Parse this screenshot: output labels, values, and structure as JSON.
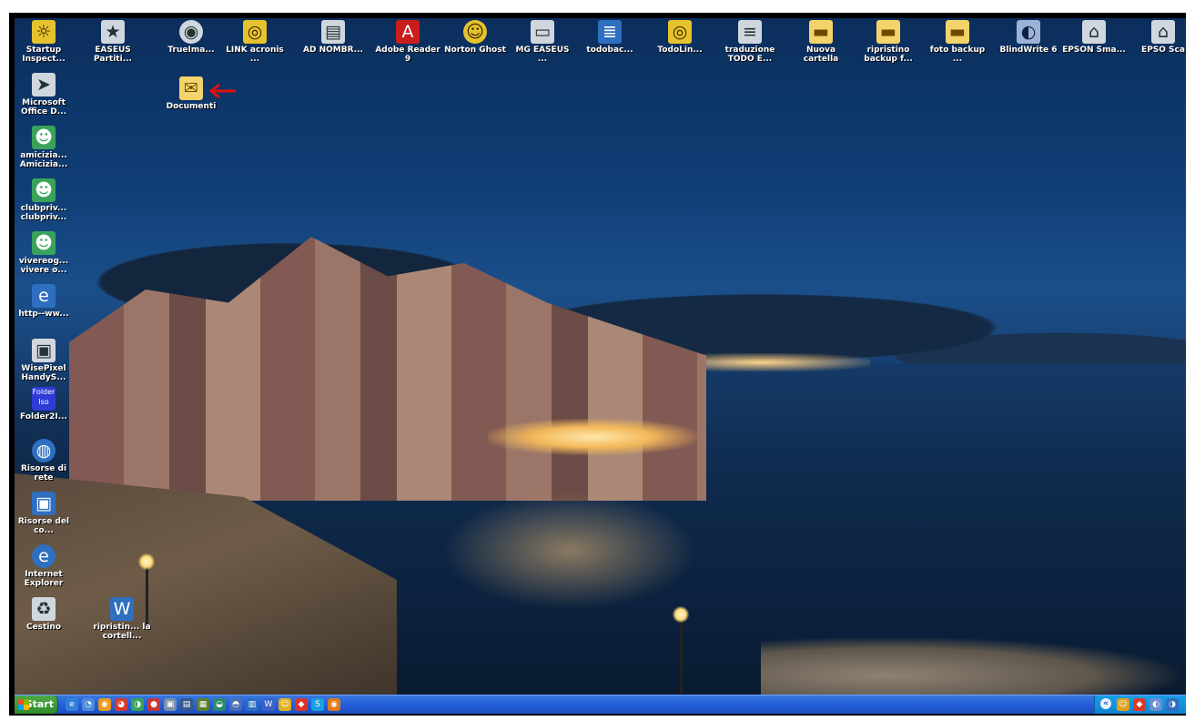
{
  "desktop_icons_top_row": [
    {
      "id": "startup-inspector",
      "label": "Startup Inspect...",
      "icon": "startup-inspector-icon"
    },
    {
      "id": "easeus-partition",
      "label": "EASEUS Partiti...",
      "icon": "easeus-icon"
    },
    {
      "id": "trueimage",
      "label": "TrueIma...",
      "icon": "trueimage-icon"
    },
    {
      "id": "link-acronis",
      "label": "LINK acronis ...",
      "icon": "image-file-icon"
    },
    {
      "id": "ad-nombre",
      "label": "AD NOMBR...",
      "icon": "document-shortcut-icon"
    },
    {
      "id": "adobe-reader",
      "label": "Adobe Reader 9",
      "icon": "adobe-reader-icon"
    },
    {
      "id": "norton-ghost",
      "label": "Norton Ghost",
      "icon": "norton-ghost-icon"
    },
    {
      "id": "mg-easeus",
      "label": "MG EASEUS ...",
      "icon": "drive-icon"
    },
    {
      "id": "todobackup-archive",
      "label": "todobac...",
      "icon": "archive-icon"
    },
    {
      "id": "todolink",
      "label": "TodoLin...",
      "icon": "image-file-icon"
    },
    {
      "id": "traduzione-todo",
      "label": "traduzione TODO E...",
      "icon": "text-file-icon"
    },
    {
      "id": "nuova-cartella",
      "label": "Nuova cartella",
      "icon": "folder-icon"
    },
    {
      "id": "ripristino-backup",
      "label": "ripristino backup f...",
      "icon": "folder-icon"
    },
    {
      "id": "foto-backup",
      "label": "foto backup ...",
      "icon": "folder-icon"
    },
    {
      "id": "blindwrite",
      "label": "BlindWrite 6",
      "icon": "disc-icon"
    },
    {
      "id": "epson-smart",
      "label": "EPSON Sma...",
      "icon": "scanner-icon"
    },
    {
      "id": "epson-scan",
      "label": "EPSO Sca",
      "icon": "scanner-icon"
    }
  ],
  "desktop_icons_left_column": [
    {
      "id": "office-doc",
      "label": "Microsoft Office D...",
      "icon": "office-shortcut-icon"
    },
    {
      "id": "amicizia",
      "label": "amicizia... Amicizia...",
      "icon": "users-icon"
    },
    {
      "id": "clubpriv",
      "label": "clubpriv... clubpriv...",
      "icon": "users-icon"
    },
    {
      "id": "vivereog",
      "label": "vivereog... vivere o...",
      "icon": "users-icon"
    },
    {
      "id": "http-ww",
      "label": "http--ww...",
      "icon": "internet-shortcut-icon"
    },
    {
      "id": "wisepixel",
      "label": "WisePixel HandyS...",
      "icon": "camera-icon"
    },
    {
      "id": "folder2iso",
      "label": "Folder2I...",
      "icon": "folder2iso-icon",
      "icon_text": "Folder Iso"
    },
    {
      "id": "risorse-rete",
      "label": "Risorse di rete",
      "icon": "network-icon"
    },
    {
      "id": "risorse-computer",
      "label": "Risorse del co...",
      "icon": "computer-icon"
    },
    {
      "id": "internet-explorer",
      "label": "Internet Explorer",
      "icon": "internet-explorer-icon"
    },
    {
      "id": "cestino",
      "label": "Cestino",
      "icon": "recycle-bin-icon"
    }
  ],
  "desktop_other_icons": [
    {
      "id": "documenti",
      "label": "Documenti",
      "icon": "documents-folder-icon"
    },
    {
      "id": "ripristino-cartella",
      "label": "ripristin... la cortell...",
      "icon": "word-document-icon"
    }
  ],
  "taskbar": {
    "start_label": "Start",
    "quick_launch": [
      "ie",
      "ql2",
      "ql3",
      "ql4",
      "ql5",
      "ql6",
      "ql7",
      "ql8",
      "ql9",
      "ql10",
      "ql11",
      "ql12",
      "ql13",
      "ql14",
      "ql15",
      "ql16",
      "ql17"
    ],
    "tray_chevron": "«"
  },
  "colors": {
    "taskbar_blue": "#245edb",
    "start_green": "#2f8a2b",
    "arrow_red": "#e01010"
  }
}
